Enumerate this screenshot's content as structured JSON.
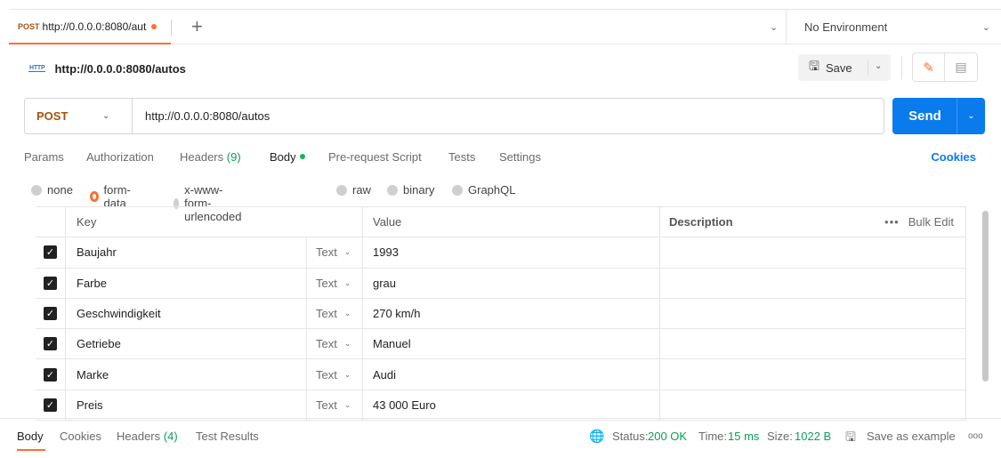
{
  "tabs": {
    "active_method": "POST",
    "active_url": "http://0.0.0.0:8080/aut",
    "plus": "+",
    "environment": "No Environment"
  },
  "request": {
    "http_icon": "HTTP",
    "title": "http://0.0.0.0:8080/autos",
    "save_label": "Save",
    "method": "POST",
    "url": "http://0.0.0.0:8080/autos",
    "send_label": "Send"
  },
  "subtabs": {
    "params": "Params",
    "authorization": "Authorization",
    "headers_label": "Headers",
    "headers_count": "(9)",
    "body": "Body",
    "prerequest": "Pre-request Script",
    "tests": "Tests",
    "settings": "Settings",
    "cookies": "Cookies"
  },
  "body_types": [
    "none",
    "form-data",
    "x-www-form-urlencoded",
    "raw",
    "binary",
    "GraphQL"
  ],
  "selected_body_type": "form-data",
  "table": {
    "headers": {
      "key": "Key",
      "value": "Value",
      "description": "Description",
      "bulk_edit": "Bulk Edit"
    },
    "rows": [
      {
        "key": "Baujahr",
        "type": "Text",
        "value": "1993",
        "description": ""
      },
      {
        "key": "Farbe",
        "type": "Text",
        "value": "grau",
        "description": ""
      },
      {
        "key": "Geschwindigkeit",
        "type": "Text",
        "value": "270 km/h",
        "description": ""
      },
      {
        "key": "Getriebe",
        "type": "Text",
        "value": "Manuel",
        "description": ""
      },
      {
        "key": "Marke",
        "type": "Text",
        "value": "Audi",
        "description": ""
      },
      {
        "key": "Preis",
        "type": "Text",
        "value": "43 000 Euro",
        "description": ""
      }
    ]
  },
  "response": {
    "tabs": [
      "Body",
      "Cookies",
      "Headers",
      "Test Results"
    ],
    "headers_count": "(4)",
    "status_label": "Status:",
    "status_value": "200 OK",
    "time_label": "Time:",
    "time_value": "15 ms",
    "size_label": "Size:",
    "size_value": "1022 B",
    "save_example": "Save as example",
    "more": "ooo"
  },
  "colors": {
    "accent": "#ff6c37",
    "send": "#097bed",
    "method": "#a6520f",
    "success": "#0f9d58"
  },
  "icons": [
    "plus-icon",
    "chevron-down-icon",
    "http-icon",
    "save-icon",
    "edit-icon",
    "documentation-icon",
    "checkbox-icon",
    "globe-icon",
    "more-icon"
  ]
}
